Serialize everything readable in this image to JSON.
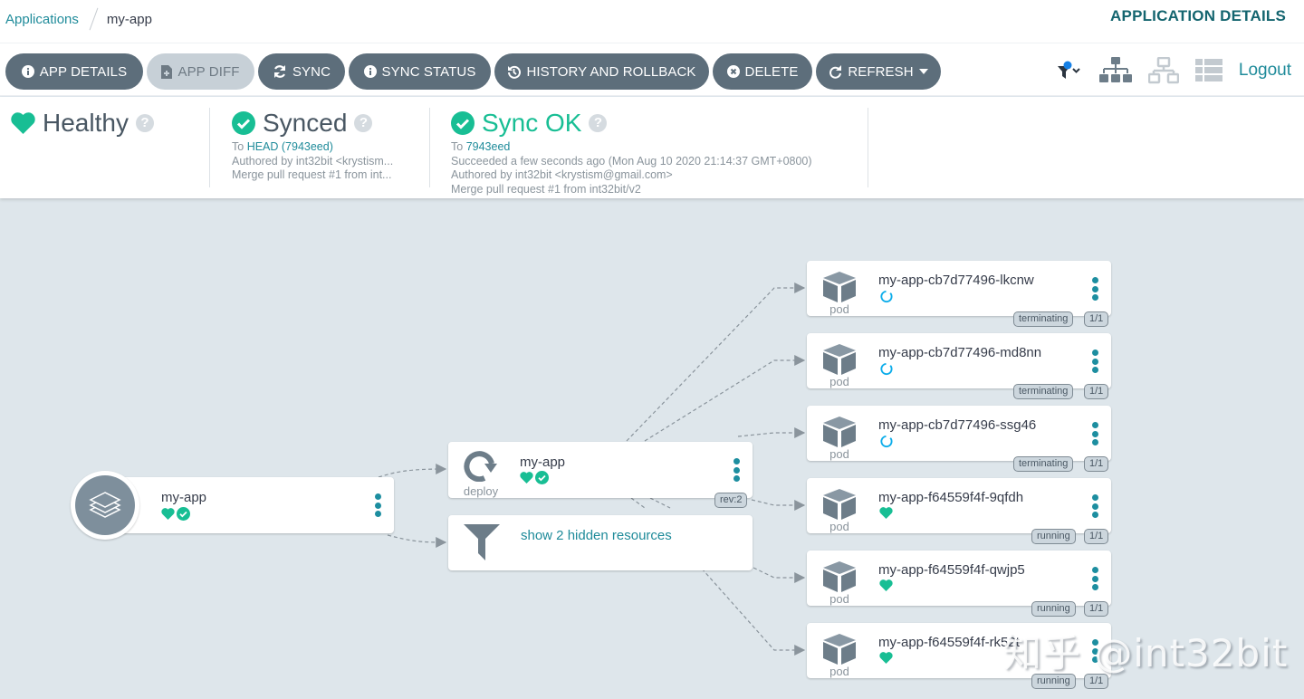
{
  "breadcrumb": {
    "parent": "Applications",
    "current": "my-app"
  },
  "page_title": "APPLICATION DETAILS",
  "toolbar": {
    "buttons": [
      {
        "label": "APP DETAILS",
        "icon": "info-circle-icon",
        "disabled": false
      },
      {
        "label": "APP DIFF",
        "icon": "file-diff-icon",
        "disabled": true
      },
      {
        "label": "SYNC",
        "icon": "sync-icon",
        "disabled": false
      },
      {
        "label": "SYNC STATUS",
        "icon": "info-circle-icon",
        "disabled": false
      },
      {
        "label": "HISTORY AND ROLLBACK",
        "icon": "history-icon",
        "disabled": false
      },
      {
        "label": "DELETE",
        "icon": "times-circle-icon",
        "disabled": false
      },
      {
        "label": "REFRESH",
        "icon": "redo-icon",
        "disabled": false,
        "has_dropdown": true
      }
    ],
    "view_icons": [
      "filter-icon",
      "tree-view-icon",
      "network-view-icon",
      "list-view-icon"
    ],
    "logout_label": "Logout"
  },
  "status": {
    "health": {
      "label": "Healthy",
      "icon": "heart-icon"
    },
    "sync": {
      "label": "Synced",
      "to_prefix": "To",
      "to_ref": "HEAD (7943eed)",
      "author": "Authored by int32bit <krystism...",
      "message": "Merge pull request #1 from int..."
    },
    "operation": {
      "label": "Sync OK",
      "to_prefix": "To",
      "to_ref": "7943eed",
      "result": "Succeeded a few seconds ago (Mon Aug 10 2020 21:14:37 GMT+0800)",
      "author": "Authored by int32bit <krystism@gmail.com>",
      "message": "Merge pull request #1 from int32bit/v2"
    }
  },
  "graph": {
    "app_node": {
      "name": "my-app",
      "health": "Healthy",
      "sync": "Synced"
    },
    "deploy_node": {
      "name": "my-app",
      "kind": "deploy",
      "revision": "rev:2"
    },
    "hidden_node": {
      "label": "show 2 hidden resources"
    },
    "pods": [
      {
        "name": "my-app-cb7d77496-lkcnw",
        "kind": "pod",
        "status": "terminating",
        "ready": "1/1",
        "state": "progressing"
      },
      {
        "name": "my-app-cb7d77496-md8nn",
        "kind": "pod",
        "status": "terminating",
        "ready": "1/1",
        "state": "progressing"
      },
      {
        "name": "my-app-cb7d77496-ssg46",
        "kind": "pod",
        "status": "terminating",
        "ready": "1/1",
        "state": "progressing"
      },
      {
        "name": "my-app-f64559f4f-9qfdh",
        "kind": "pod",
        "status": "running",
        "ready": "1/1",
        "state": "healthy"
      },
      {
        "name": "my-app-f64559f4f-qwjp5",
        "kind": "pod",
        "status": "running",
        "ready": "1/1",
        "state": "healthy"
      },
      {
        "name": "my-app-f64559f4f-rk52t",
        "kind": "pod",
        "status": "running",
        "ready": "1/1",
        "state": "healthy"
      }
    ]
  },
  "watermark": "知乎 @int32bit",
  "colors": {
    "accent": "#1f8b9a",
    "healthy": "#18be94",
    "progressing": "#0dadea",
    "button": "#5d6e7b",
    "canvas": "#dee6eb"
  }
}
